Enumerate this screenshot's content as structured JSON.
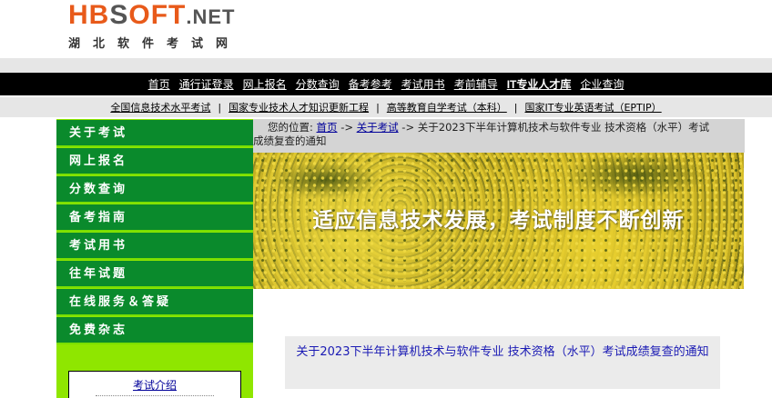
{
  "logo": {
    "part1": "HB",
    "part2": "S",
    "part3": "OFT",
    "part4": ".NET",
    "subtitle": "湖北软件考试网"
  },
  "main_nav": [
    "首页",
    "通行证登录",
    "网上报名",
    "分数查询",
    "备考参考",
    "考试用书",
    "考前辅导",
    "IT专业人才库",
    "企业查询"
  ],
  "sub_nav": [
    "全国信息技术水平考试",
    "国家专业技术人才知识更新工程",
    "高等教育自学考试（本科）",
    "国家IT专业英语考试（EPTIP）"
  ],
  "sidebar": {
    "items": [
      "关于考试",
      "网上报名",
      "分数查询",
      "备考指南",
      "考试用书",
      "往年试题",
      "在线服务＆答疑",
      "免费杂志"
    ],
    "box_link": "考试介绍"
  },
  "breadcrumb": {
    "prefix": "您的位置:",
    "home": "首页",
    "arrow1": "->",
    "section": "关于考试",
    "arrow2": "->",
    "current_line1": "关于2023下半年计算机技术与软件专业 技术资格（水平）考试",
    "current_line2": "成绩复查的通知"
  },
  "banner": {
    "slogan": "适应信息技术发展，考试制度不断创新"
  },
  "article": {
    "title": "关于2023下半年计算机技术与软件专业 技术资格（水平）考试成绩复查的通知"
  },
  "colors": {
    "logo_orange": "#e85a1a",
    "nav_black": "#000000",
    "sidebar_green": "#0a8a2c",
    "sidebar_lime": "#8fe600",
    "link_blue": "#000099"
  }
}
